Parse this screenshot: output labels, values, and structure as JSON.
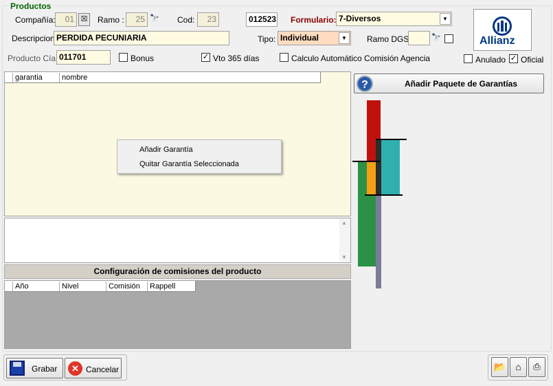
{
  "group_title": "Productos",
  "form": {
    "compania_label": "Compañía:",
    "compania_value": "01",
    "ramo_label": "Ramo :",
    "ramo_value": "25",
    "cod_label": "Cod:",
    "cod_value": "23",
    "code_box": "012523",
    "formulario_label": "Formulario:",
    "formulario_value": "7-Diversos",
    "descripcion_label": "Descripcion",
    "descripcion_value": "PERDIDA PECUNIARIA",
    "tipo_label": "Tipo:",
    "tipo_value": "Individual",
    "ramo_dgs_label": "Ramo DGS:",
    "ramo_dgs_value": "",
    "producto_cia_label": "Producto Cía:",
    "producto_cia_value": "011701",
    "bonus_label": "Bonus",
    "bonus_checked": false,
    "vto_label": "Vto 365 días",
    "vto_checked": true,
    "calculo_label": "Calculo Automático Comisión Agencia",
    "calculo_checked": false,
    "anulado_label": "Anulado",
    "anulado_checked": false,
    "oficial_label": "Oficial",
    "oficial_checked": true
  },
  "logo": {
    "text": "Allianz",
    "color": "#003781"
  },
  "garantias_grid": {
    "columns": [
      "garantia",
      "nombre"
    ]
  },
  "context_menu": {
    "items": [
      "Añadir Garantía",
      "Quitar Garantía Seleccionada"
    ]
  },
  "add_package_button": "Añadir Paquete de Garantías",
  "comisiones": {
    "title": "Configuración de comisiones del producto",
    "columns": [
      "Año",
      "Nivel",
      "Comisión",
      "Rappell"
    ]
  },
  "footer": {
    "grabar": "Grabar",
    "cancelar": "Cancelar"
  },
  "colors": {
    "accent_green": "#006400",
    "form_label_red": "#8b0000",
    "field_bg": "#fffbe3",
    "tipo_bg": "#ffdcc0"
  }
}
